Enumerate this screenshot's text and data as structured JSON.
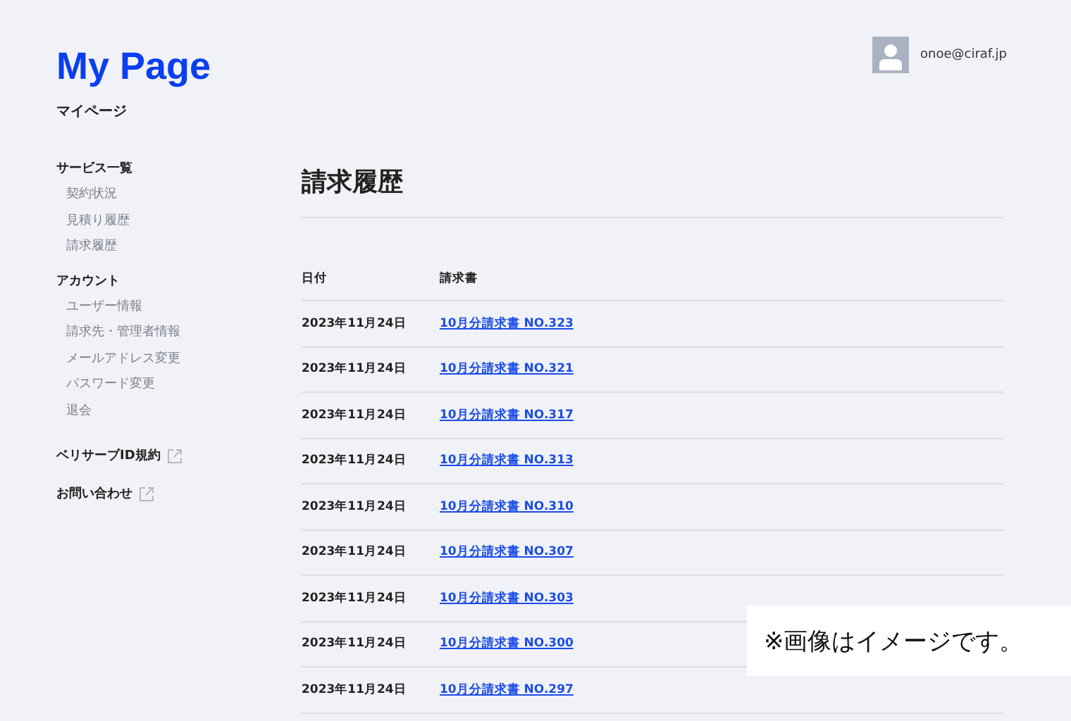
{
  "brand": {
    "title": "My Page",
    "subtitle": "マイページ"
  },
  "user": {
    "email": "onoe@ciraf.jp"
  },
  "sidebar": {
    "groups": [
      {
        "heading": "サービス一覧",
        "items": [
          "契約状況",
          "見積り履歴",
          "請求履歴"
        ]
      },
      {
        "heading": "アカウント",
        "items": [
          "ユーザー情報",
          "請求先・管理者情報",
          "メールアドレス変更",
          "パスワード変更",
          "退会"
        ]
      }
    ],
    "external_links": [
      "ベリサーブID規約",
      "お問い合わせ"
    ]
  },
  "page_title": "請求履歴",
  "table": {
    "columns": [
      "日付",
      "請求書"
    ],
    "rows": [
      {
        "date": "2023年11月24日",
        "invoice": "10月分請求書 NO.323"
      },
      {
        "date": "2023年11月24日",
        "invoice": "10月分請求書 NO.321"
      },
      {
        "date": "2023年11月24日",
        "invoice": "10月分請求書 NO.317"
      },
      {
        "date": "2023年11月24日",
        "invoice": "10月分請求書 NO.313"
      },
      {
        "date": "2023年11月24日",
        "invoice": "10月分請求書 NO.310"
      },
      {
        "date": "2023年11月24日",
        "invoice": "10月分請求書 NO.307"
      },
      {
        "date": "2023年11月24日",
        "invoice": "10月分請求書 NO.303"
      },
      {
        "date": "2023年11月24日",
        "invoice": "10月分請求書 NO.300"
      },
      {
        "date": "2023年11月24日",
        "invoice": "10月分請求書 NO.297"
      }
    ]
  },
  "image_note": "※画像はイメージです。"
}
